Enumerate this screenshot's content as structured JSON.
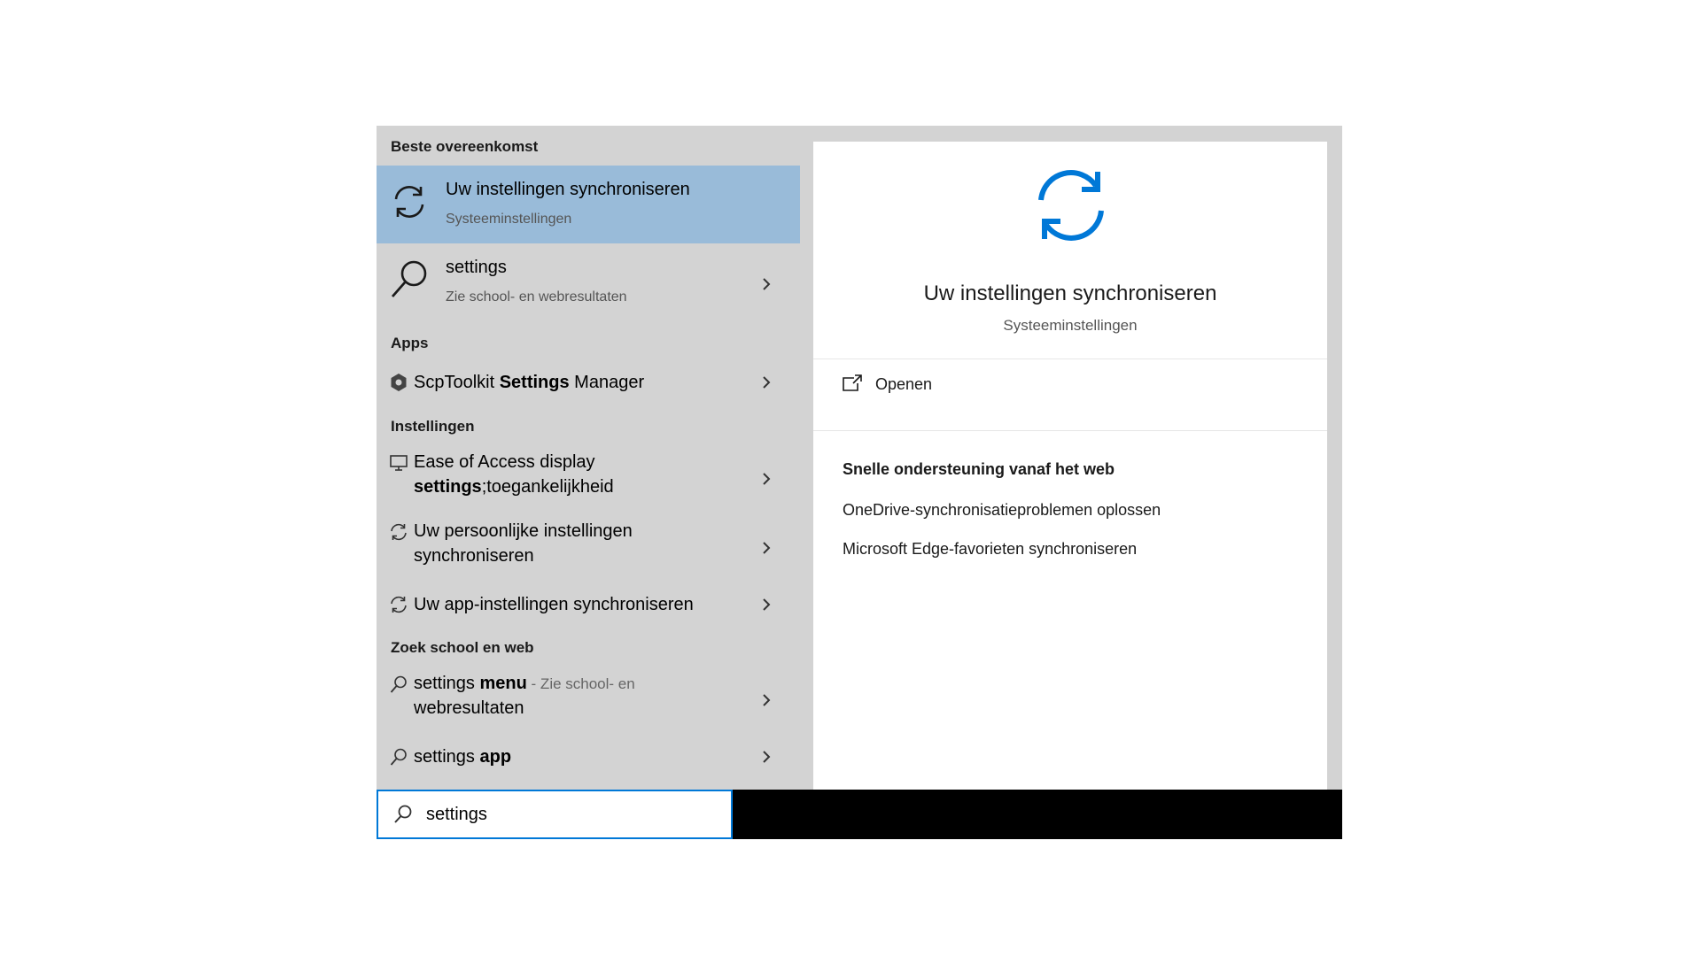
{
  "left": {
    "best_match_header": "Beste overeenkomst",
    "best_match": {
      "title": "Uw instellingen synchroniseren",
      "subtitle": "Systeeminstellingen",
      "icon": "sync-icon"
    },
    "web_suggestion": {
      "title": "settings",
      "subtitle": "Zie school- en webresultaten",
      "icon": "search-icon"
    },
    "apps_header": "Apps",
    "apps": [
      {
        "prefix": "ScpToolkit ",
        "bold": "Settings",
        "suffix": " Manager",
        "icon": "gear-icon"
      }
    ],
    "settings_header": "Instellingen",
    "settings_items": [
      {
        "line1": "Ease of Access display",
        "line2_bold": "settings",
        "line2_rest": ";toegankelijkheid",
        "icon": "monitor-icon"
      },
      {
        "line1": "Uw persoonlijke instellingen",
        "line2": "synchroniseren",
        "icon": "sync-icon"
      },
      {
        "line1": "Uw app-instellingen synchroniseren",
        "icon": "sync-icon"
      }
    ],
    "web_header": "Zoek school en web",
    "web_items": [
      {
        "prefix": "settings ",
        "bold": "menu",
        "dim": " - Zie school- en",
        "line2": "webresultaten",
        "icon": "search-icon"
      },
      {
        "prefix": "settings ",
        "bold": "app",
        "icon": "search-icon"
      }
    ]
  },
  "right": {
    "title": "Uw instellingen synchroniseren",
    "subtitle": "Systeeminstellingen",
    "open_label": "Openen",
    "web_support_title": "Snelle ondersteuning vanaf het web",
    "web_links": [
      "OneDrive-synchronisatieproblemen oplossen",
      "Microsoft Edge-favorieten synchroniseren"
    ],
    "accent_color": "#0078d7"
  },
  "search": {
    "value": "settings"
  },
  "colors": {
    "panel_bg": "#d3d3d3",
    "selected_bg": "#99bbd9",
    "accent": "#0078d7"
  }
}
